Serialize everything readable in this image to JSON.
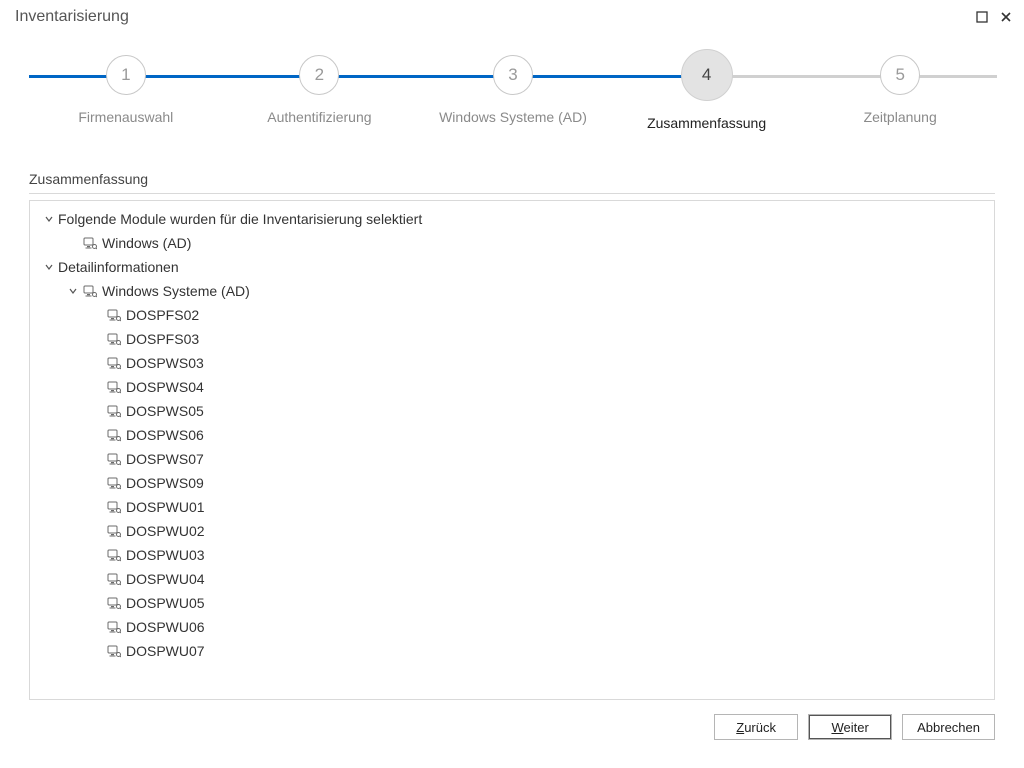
{
  "window": {
    "title": "Inventarisierung"
  },
  "wizard": {
    "active_index": 3,
    "steps": [
      {
        "num": "1",
        "label": "Firmenauswahl"
      },
      {
        "num": "2",
        "label": "Authentifizierung"
      },
      {
        "num": "3",
        "label": "Windows Systeme (AD)"
      },
      {
        "num": "4",
        "label": "Zusammenfassung"
      },
      {
        "num": "5",
        "label": "Zeitplanung"
      }
    ]
  },
  "section": {
    "heading": "Zusammenfassung"
  },
  "tree": {
    "modules_heading": "Folgende Module wurden für die Inventarisierung selektiert",
    "modules": [
      "Windows (AD)"
    ],
    "details_heading": "Detailinformationen",
    "details_group": "Windows Systeme (AD)",
    "hosts": [
      "DOSPFS02",
      "DOSPFS03",
      "DOSPWS03",
      "DOSPWS04",
      "DOSPWS05",
      "DOSPWS06",
      "DOSPWS07",
      "DOSPWS09",
      "DOSPWU01",
      "DOSPWU02",
      "DOSPWU03",
      "DOSPWU04",
      "DOSPWU05",
      "DOSPWU06",
      "DOSPWU07"
    ]
  },
  "footer": {
    "back_full": "Zurück",
    "back_ul": "Z",
    "back_rest": "urück",
    "next_full": "Weiter",
    "next_ul": "W",
    "next_rest": "eiter",
    "cancel": "Abbrechen"
  }
}
